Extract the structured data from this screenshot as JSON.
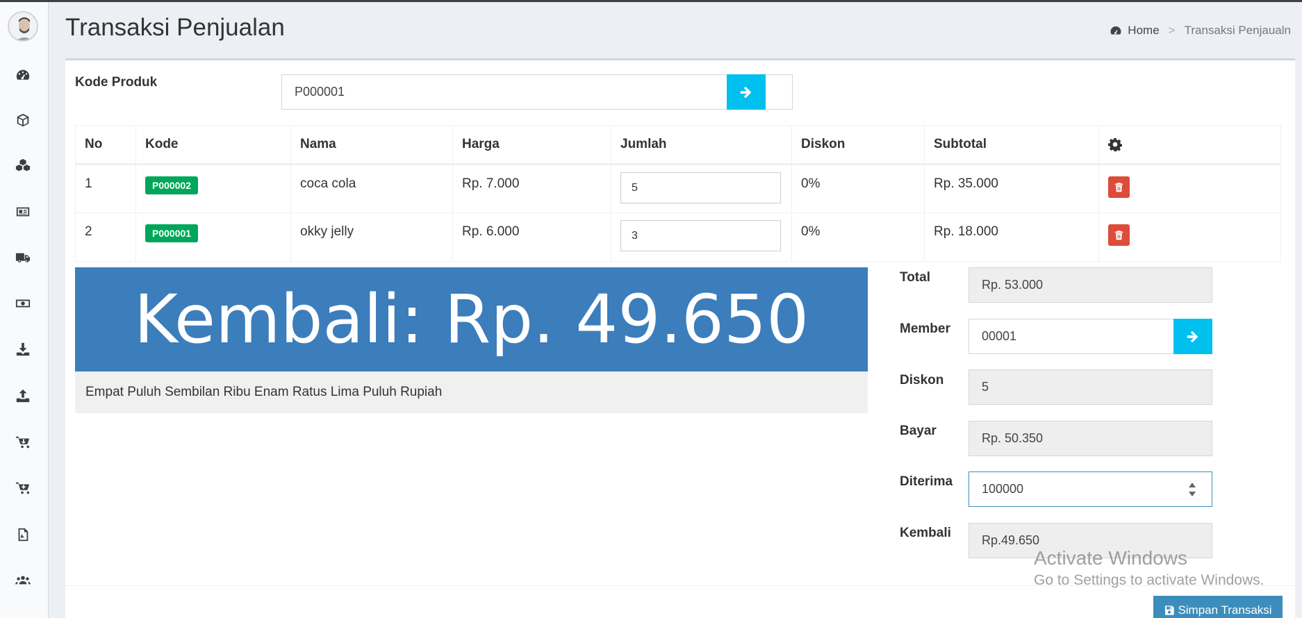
{
  "header": {
    "title": "Transaksi Penjualan",
    "breadcrumb_home": "Home",
    "breadcrumb_sep": ">",
    "breadcrumb_current": "Transaksi Penjaualn"
  },
  "sidebar": {
    "icons": [
      "dashboard-icon",
      "cube-icon",
      "cubes-icon",
      "id-card-icon",
      "truck-icon",
      "money-icon",
      "download-icon",
      "upload-icon",
      "cart-arrow-icon",
      "cart-plus-icon",
      "pdf-file-icon",
      "users-icon"
    ]
  },
  "form": {
    "kode_produk_label": "Kode Produk",
    "kode_produk_value": "P000001"
  },
  "table": {
    "headers": [
      "No",
      "Kode",
      "Nama",
      "Harga",
      "Jumlah",
      "Diskon",
      "Subtotal"
    ],
    "action_icon": "gear-icon",
    "rows": [
      {
        "no": "1",
        "kode": "P000002",
        "nama": "coca cola",
        "harga": "Rp. 7.000",
        "jumlah": "5",
        "diskon": "0%",
        "subtotal": "Rp. 35.000"
      },
      {
        "no": "2",
        "kode": "P000001",
        "nama": "okky jelly",
        "harga": "Rp. 6.000",
        "jumlah": "3",
        "diskon": "0%",
        "subtotal": "Rp. 18.000"
      }
    ]
  },
  "display": {
    "kembali_big": "Kembali: Rp. 49.650",
    "terbilang": "Empat Puluh Sembilan Ribu Enam Ratus Lima Puluh Rupiah"
  },
  "summary": {
    "total_label": "Total",
    "total_value": "Rp. 53.000",
    "member_label": "Member",
    "member_value": "00001",
    "diskon_label": "Diskon",
    "diskon_value": "5",
    "bayar_label": "Bayar",
    "bayar_value": "Rp. 50.350",
    "diterima_label": "Diterima",
    "diterima_value": "100000",
    "kembali_label": "Kembali",
    "kembali_value": "Rp.49.650"
  },
  "actions": {
    "save_label": "Simpan Transaksi"
  },
  "watermark": {
    "line1": "Activate Windows",
    "line2": "Go to Settings to activate Windows."
  },
  "colors": {
    "accent": "#00c0ef",
    "primary": "#3c8dbc",
    "banner": "#3c7dbc",
    "badge": "#00a65a",
    "danger": "#dd4b39"
  }
}
